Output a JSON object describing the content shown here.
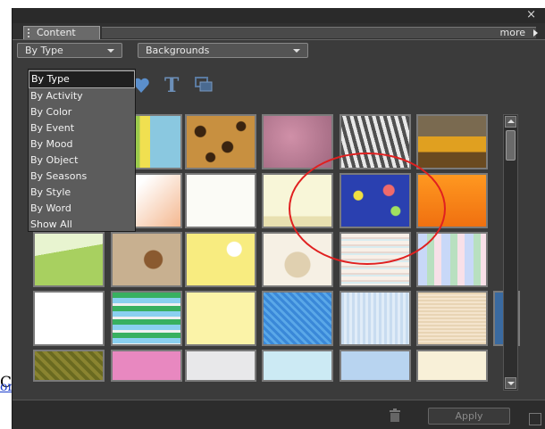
{
  "panel": {
    "close_glyph": "×",
    "tab_label": "Content",
    "more_label": "more",
    "filter_select": {
      "value": "By Type"
    },
    "category_select": {
      "value": "Backgrounds"
    },
    "dropdown_options": [
      "By Type",
      "By Activity",
      "By Color",
      "By Event",
      "By Mood",
      "By Object",
      "By Seasons",
      "By Style",
      "By Word",
      "Show All"
    ],
    "selected_option": "By Type",
    "toolbar_icons": [
      "heart-icon",
      "text-icon",
      "frame-icon"
    ],
    "apply_label": "Apply"
  },
  "background_text": {
    "left_fragment": "C",
    "link_fragment": "or",
    "right_fragment": "C"
  },
  "colors": {
    "panel_bg": "#3b3b3b",
    "annotation_circle": "#e02020",
    "text_icon": "#6c8fb8",
    "heart_icon": "#5b8fcc"
  },
  "thumbnails": [
    [
      "thumb-green-cartoon",
      "thumb-leopard",
      "thumb-pink-texture",
      "thumb-zebra",
      "thumb-autumn-photo"
    ],
    [
      "thumb-peach-gradient",
      "thumb-white-dots",
      "thumb-cream-border",
      "thumb-balloons-blue",
      "thumb-orange-wire"
    ],
    [
      "thumb-green-field",
      "thumb-bear-sand",
      "thumb-yellow-bubbles",
      "thumb-bear-cream",
      "thumb-stripes-dino",
      "thumb-pastel-stripes"
    ],
    [
      "thumb-white-frame",
      "thumb-green-stripes",
      "thumb-yellow-plain",
      "thumb-blue-pattern",
      "thumb-blue-grid",
      "thumb-beige-texture",
      "thumb-blue-tile"
    ],
    [
      "thumb-olive-texture",
      "thumb-pink-paper",
      "thumb-grey-dots",
      "thumb-cyan-plain",
      "thumb-blue-dots",
      "thumb-cream-plain",
      "thumb-peach-plain"
    ]
  ]
}
